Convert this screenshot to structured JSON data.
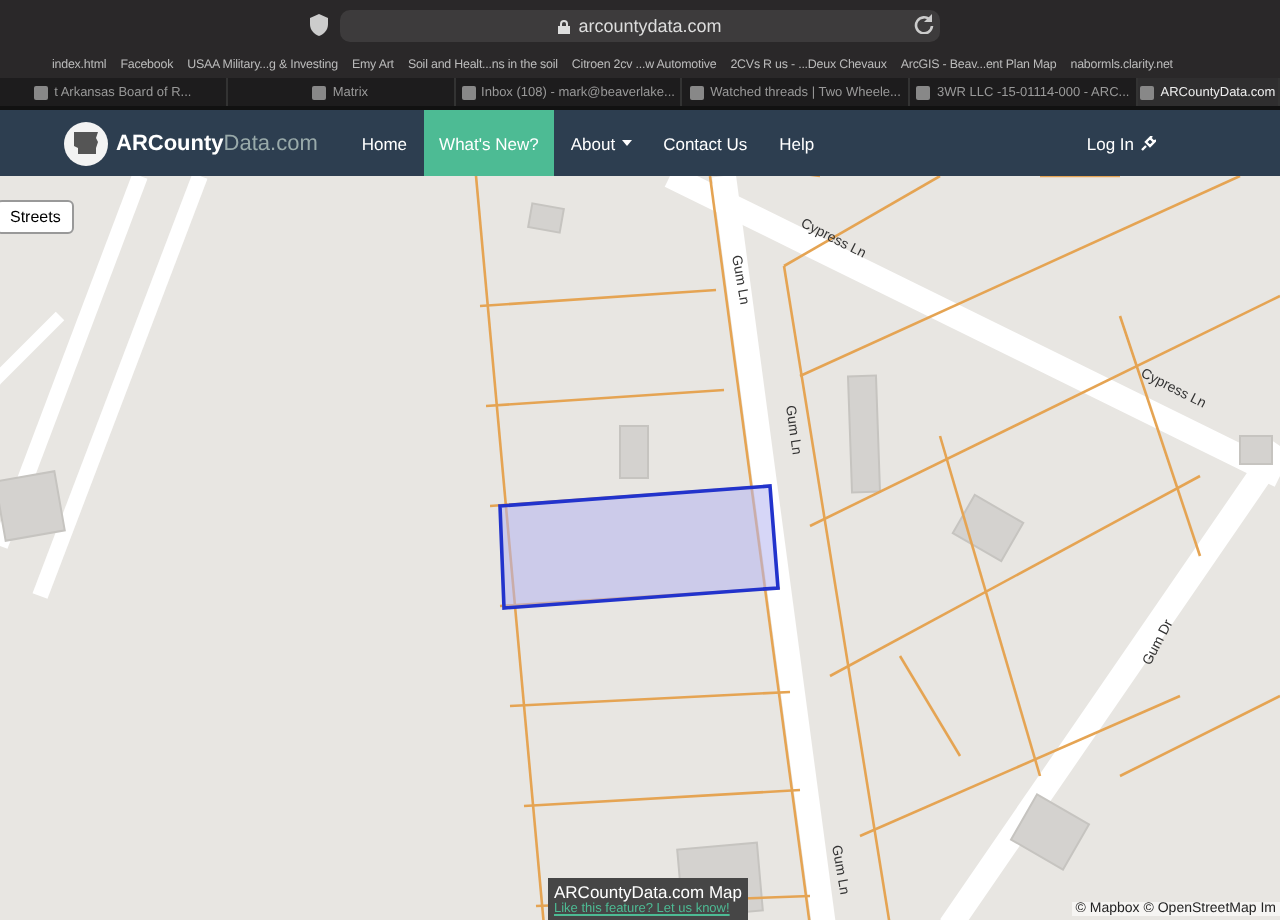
{
  "browser": {
    "url": "arcountydata.com",
    "bookmarks": [
      "index.html",
      "Facebook",
      "USAA Military...g & Investing",
      "Emy Art",
      "Soil and Healt...ns in the soil",
      "Citroen 2cv ...w Automotive",
      "2CVs R us - ...Deux Chevaux",
      "ArcGIS - Beav...ent Plan Map",
      "nabormls.clarity.net"
    ],
    "tabs": [
      {
        "label": "t Arkansas Board of R...",
        "selected": false
      },
      {
        "label": "Matrix",
        "selected": false
      },
      {
        "label": "Inbox (108) - mark@beaverlake...",
        "selected": false
      },
      {
        "label": "Watched threads | Two Wheele...",
        "selected": false
      },
      {
        "label": "3WR LLC -15-01114-000 - ARC...",
        "selected": false
      },
      {
        "label": "ARCountyData.com",
        "selected": true
      }
    ]
  },
  "nav": {
    "brand_main": "ARCounty",
    "brand_suffix": "Data.com",
    "items": [
      {
        "label": "Home",
        "kind": "link",
        "selected": false
      },
      {
        "label": "What's New?",
        "kind": "link",
        "selected": true
      },
      {
        "label": "About",
        "kind": "dropdown",
        "selected": false
      },
      {
        "label": "Contact Us",
        "kind": "link",
        "selected": false
      },
      {
        "label": "Help",
        "kind": "link",
        "selected": false
      }
    ],
    "login": "Log In"
  },
  "map": {
    "layer_button": "Streets",
    "street_labels": [
      "Gum Ln",
      "Cypress Ln",
      "Cypress Ln",
      "Gum Ln",
      "Gum Dr",
      "Gum Ln"
    ],
    "caption_title": "ARCountyData.com Map",
    "caption_link": "Like this feature? Let us know!",
    "attribution": "© Mapbox © OpenStreetMap Im"
  }
}
